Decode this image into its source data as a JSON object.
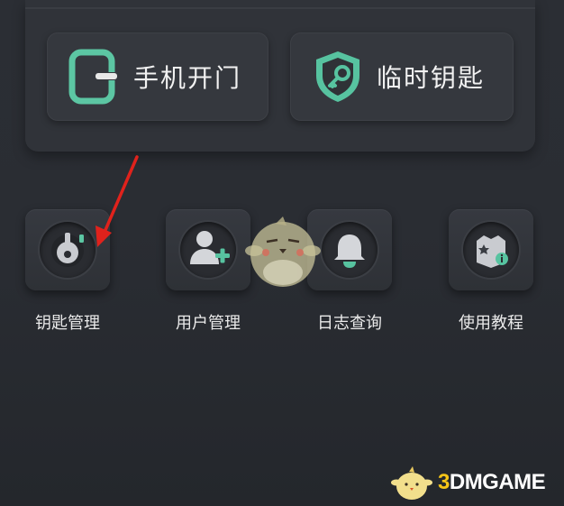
{
  "quick_actions": [
    {
      "label": "手机开门",
      "icon": "phone-door-icon"
    },
    {
      "label": "临时钥匙",
      "icon": "shield-key-icon"
    }
  ],
  "tiles": [
    {
      "label": "钥匙管理",
      "icon": "key-icon"
    },
    {
      "label": "用户管理",
      "icon": "add-user-icon"
    },
    {
      "label": "日志查询",
      "icon": "bell-icon"
    },
    {
      "label": "使用教程",
      "icon": "tutorial-icon"
    }
  ],
  "watermark": {
    "brand": "3DMGAME",
    "brand_prefix": "3",
    "brand_rest": "DMGAME"
  },
  "colors": {
    "accent_green": "#57c3a0",
    "annotation_red": "#e0221c",
    "background": "#2a2d33"
  }
}
